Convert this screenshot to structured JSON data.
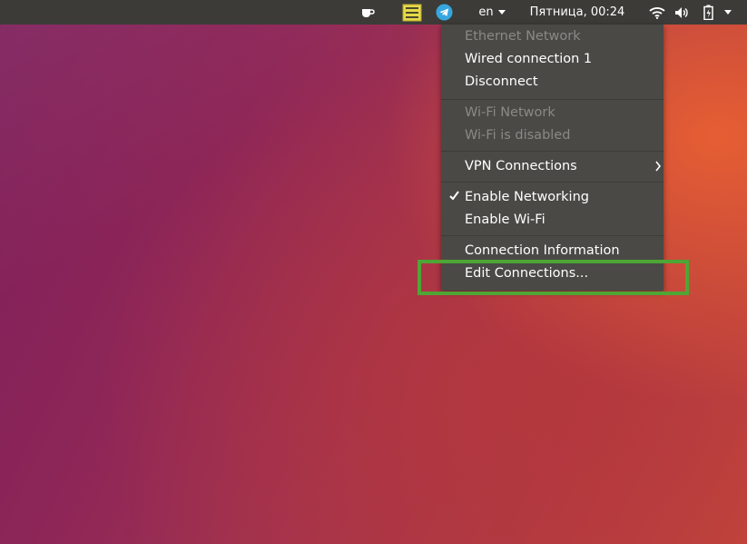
{
  "topbar": {
    "language": "en",
    "datetime": "Пятница, 00:24",
    "icons": [
      "coffee-cup-icon",
      "notes-icon",
      "telegram-icon",
      "wifi-icon",
      "volume-icon",
      "battery-icon",
      "chevron-down-icon"
    ]
  },
  "network_menu": {
    "ethernet_header": "Ethernet Network",
    "wired_connection": "Wired connection 1",
    "disconnect": "Disconnect",
    "wifi_header": "Wi-Fi Network",
    "wifi_disabled": "Wi-Fi is disabled",
    "vpn_connections": "VPN Connections",
    "enable_networking": "Enable Networking",
    "enable_networking_checked": true,
    "enable_wifi": "Enable Wi-Fi",
    "connection_information": "Connection Information",
    "edit_connections": "Edit Connections..."
  },
  "colors": {
    "panel": "#3c3b37",
    "menu_bg": "#4a4946",
    "disabled_text": "#8a8986",
    "highlight_border": "#4ea635",
    "wallpaper_orange": "#e86032",
    "wallpaper_purple": "#7e1f5c"
  }
}
